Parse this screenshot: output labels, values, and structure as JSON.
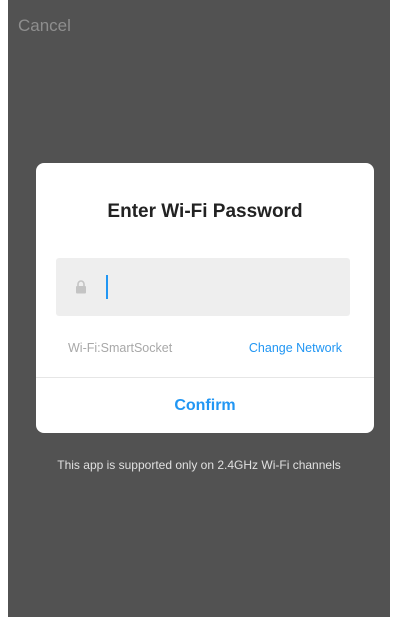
{
  "header": {
    "cancel_label": "Cancel"
  },
  "dialog": {
    "title": "Enter Wi-Fi Password",
    "password": {
      "value": "",
      "icon": "lock-icon"
    },
    "wifi_label": "Wi-Fi:SmartSocket",
    "change_network_label": "Change Network",
    "confirm_label": "Confirm"
  },
  "footer": {
    "note": "This app is supported only on 2.4GHz Wi-Fi channels"
  },
  "colors": {
    "accent": "#2196f3",
    "backdrop": "#525252",
    "dialog_bg": "#ffffff",
    "field_bg": "#eeeeee"
  }
}
